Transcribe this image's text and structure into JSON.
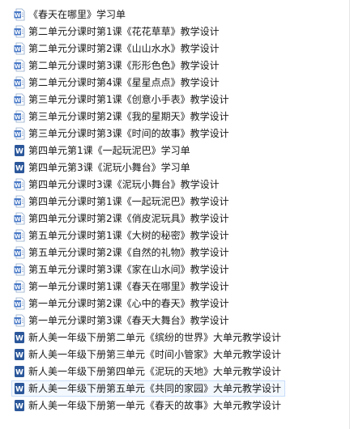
{
  "files": [
    {
      "name": "《春天在哪里》学习单",
      "icon": "word-doc-icon-outline"
    },
    {
      "name": "第二单元分课时第1课《花花草草》教学设计",
      "icon": "word-doc-icon-outline"
    },
    {
      "name": "第二单元分课时第2课《山山水水》教学设计",
      "icon": "word-doc-icon-outline"
    },
    {
      "name": "第二单元分课时第3课《形形色色》教学设计",
      "icon": "word-doc-icon-outline"
    },
    {
      "name": "第二单元分课时第4课《星星点点》教学设计",
      "icon": "word-doc-icon-outline"
    },
    {
      "name": "第三单元分课时第1课《创意小手表》教学设计",
      "icon": "word-doc-icon-outline"
    },
    {
      "name": "第三单元分课时第2课《我的星期天》教学设计",
      "icon": "word-doc-icon-outline"
    },
    {
      "name": "第三单元分课时第3课《时间的故事》教学设计",
      "icon": "word-doc-icon-outline"
    },
    {
      "name": "第四单元第1课《一起玩泥巴》学习单",
      "icon": "word-doc-icon-filled"
    },
    {
      "name": "第四单元第3课《泥玩小舞台》学习单",
      "icon": "word-doc-icon-filled"
    },
    {
      "name": "第四单元分课时3课《泥玩小舞台》教学设计",
      "icon": "word-doc-icon-outline"
    },
    {
      "name": "第四单元分课时第1课《一起玩泥巴》教学设计",
      "icon": "word-doc-icon-outline"
    },
    {
      "name": "第四单元分课时第2课《俏皮泥玩具》教学设计",
      "icon": "word-doc-icon-outline"
    },
    {
      "name": "第五单元分课时第1课《大树的秘密》教学设计",
      "icon": "word-doc-icon-outline"
    },
    {
      "name": "第五单元分课时第2课《自然的礼物》教学设计",
      "icon": "word-doc-icon-outline"
    },
    {
      "name": "第五单元分课时第3课《家在山水间》教学设计",
      "icon": "word-doc-icon-outline"
    },
    {
      "name": "第一单元分课时第1课《春天在哪里》教学设计",
      "icon": "word-doc-icon-outline"
    },
    {
      "name": "第一单元分课时第2课《心中的春天》教学设计",
      "icon": "word-doc-icon-outline"
    },
    {
      "name": "第一单元分课时第3课《春天大舞台》教学设计",
      "icon": "word-doc-icon-outline"
    },
    {
      "name": "新人美一年级下册第二单元《缤纷的世界》大单元教学设计",
      "icon": "word-doc-icon-filled"
    },
    {
      "name": "新人美一年级下册第三单元《时间小管家》大单元教学设计",
      "icon": "word-doc-icon-filled"
    },
    {
      "name": "新人美一年级下册第四单元《泥玩的天地》大单元教学设计",
      "icon": "word-doc-icon-filled"
    },
    {
      "name": "新人美一年级下册第五单元《共同的家园》大单元教学设计",
      "icon": "word-doc-icon-filled",
      "selected": true
    },
    {
      "name": "新人美一年级下册第一单元《春天的故事》大单元教学设计",
      "icon": "word-doc-icon-filled"
    }
  ],
  "colors": {
    "word_blue": "#2b579a",
    "word_blue_light": "#4a7ac7",
    "outline_page": "#ffffff",
    "selection_bg": "#f3f8fe",
    "selection_border": "#c9defa"
  }
}
